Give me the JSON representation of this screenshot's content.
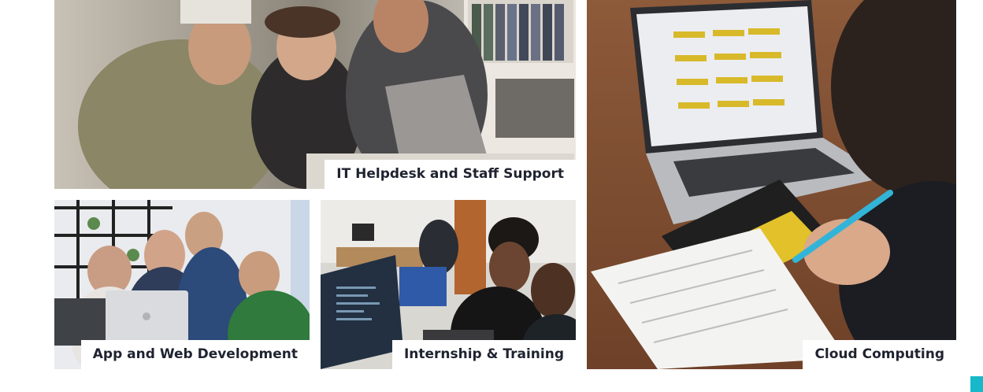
{
  "services": {
    "tiles": [
      {
        "label": "IT Helpdesk and Staff Support"
      },
      {
        "label": "App and Web Development"
      },
      {
        "label": "Internship & Training"
      },
      {
        "label": "Cloud Computing"
      }
    ]
  },
  "colors": {
    "label_bg": "#ffffff",
    "label_text": "#1f2330",
    "accent": "#17b8c9"
  }
}
